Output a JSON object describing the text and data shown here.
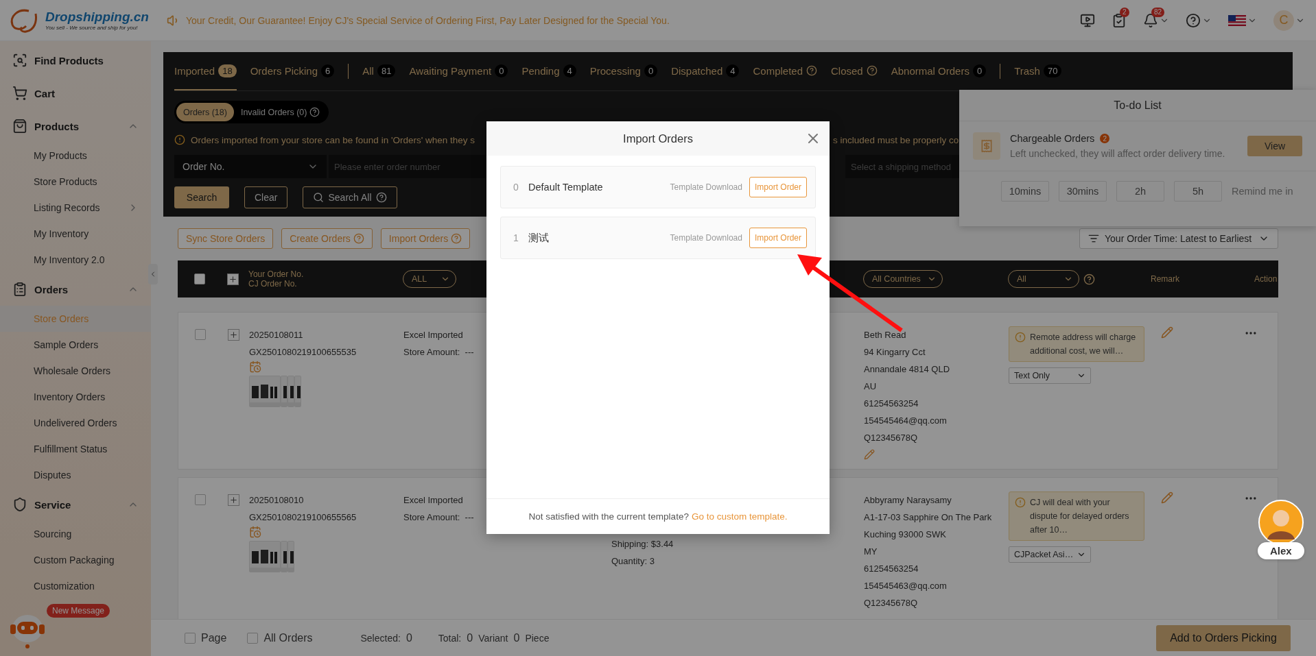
{
  "header": {
    "brand": "Dropshipping.cn",
    "tagline": "You sell - We source and ship for you!",
    "announcement": "Your Credit, Our Guarantee! Enjoy CJ's Special Service of Ordering First, Pay Later Designed for the Special You.",
    "tasks_badge": "2",
    "notifications_badge": "82",
    "avatar_letter": "C"
  },
  "sidebar": {
    "links": [
      {
        "label": "Find Products"
      },
      {
        "label": "Cart"
      }
    ],
    "groups": [
      {
        "label": "Products",
        "expanded": true,
        "children": [
          {
            "label": "My Products",
            "kind": "link",
            "selected": false
          },
          {
            "label": "Store Products",
            "kind": "link",
            "selected": false
          },
          {
            "label": "Listing Records",
            "kind": "submenu",
            "selected": false
          },
          {
            "label": "My Inventory",
            "kind": "link",
            "selected": false
          },
          {
            "label": "My Inventory 2.0",
            "kind": "link",
            "selected": false
          }
        ]
      },
      {
        "label": "Orders",
        "expanded": true,
        "children": [
          {
            "label": "Store Orders",
            "kind": "link",
            "selected": true
          },
          {
            "label": "Sample Orders",
            "kind": "link",
            "selected": false
          },
          {
            "label": "Wholesale Orders",
            "kind": "link",
            "selected": false
          },
          {
            "label": "Inventory Orders",
            "kind": "link",
            "selected": false
          },
          {
            "label": "Undelivered Orders",
            "kind": "link",
            "selected": false
          },
          {
            "label": "Fulfillment Status",
            "kind": "link",
            "selected": false
          },
          {
            "label": "Disputes",
            "kind": "link",
            "selected": false
          }
        ]
      },
      {
        "label": "Service",
        "expanded": true,
        "children": [
          {
            "label": "Sourcing",
            "kind": "link",
            "selected": false
          },
          {
            "label": "Custom Packaging",
            "kind": "link",
            "selected": false
          },
          {
            "label": "Customization",
            "kind": "link",
            "selected": false
          }
        ]
      }
    ]
  },
  "chat": {
    "badge": "New Message"
  },
  "tab_groups": [
    [
      {
        "label": "Imported",
        "kind": "count",
        "count": "18",
        "selected": true
      },
      {
        "label": "Orders Picking",
        "kind": "count",
        "count": "6",
        "selected": false
      }
    ],
    [
      {
        "label": "All",
        "kind": "count",
        "count": "81",
        "selected": false
      },
      {
        "label": "Awaiting Payment",
        "kind": "count",
        "count": "0",
        "selected": false
      },
      {
        "label": "Pending",
        "kind": "count",
        "count": "4",
        "selected": false
      },
      {
        "label": "Processing",
        "kind": "count",
        "count": "0",
        "selected": false
      },
      {
        "label": "Dispatched",
        "kind": "count",
        "count": "4",
        "selected": false
      },
      {
        "label": "Completed",
        "kind": "help",
        "selected": false
      },
      {
        "label": "Closed",
        "kind": "help",
        "selected": false
      },
      {
        "label": "Abnormal Orders",
        "kind": "count",
        "count": "0",
        "selected": false
      }
    ],
    [
      {
        "label": "Trash",
        "kind": "count",
        "count": "70",
        "selected": false
      }
    ]
  ],
  "sub_tabs": [
    {
      "label": "Orders (18)",
      "kind": "plain",
      "selected": true
    },
    {
      "label": "Invalid Orders (0)",
      "kind": "help",
      "selected": false
    }
  ],
  "notice": {
    "before": "Orders imported from your store can be found in 'Orders' when they s",
    "after": "s included must be properly co"
  },
  "filters": {
    "field": "Order No.",
    "search_placeholder": "Please enter order number",
    "shipping_placeholder": "Select a shipping method",
    "search": "Search",
    "clear": "Clear",
    "search_all": "Search All"
  },
  "toolbar": [
    {
      "label": "Sync Store Orders",
      "kind": "plain"
    },
    {
      "label": "Create Orders",
      "kind": "help"
    },
    {
      "label": "Import Orders",
      "kind": "help"
    }
  ],
  "sort": "Your Order Time: Latest to Earliest",
  "table": {
    "checked": false,
    "order_line1": "Your Order No.",
    "order_line2": "CJ Order No.",
    "status_filter": "ALL",
    "country_filter": "All Countries",
    "remark_filter": "All",
    "remark": "Remark",
    "action": "Action"
  },
  "rows": [
    {
      "checked": false,
      "order_no": "20250108011",
      "cj_order_no": "GX2501080219100655535",
      "thumbnails": [
        {
          "kind": "picture"
        },
        {
          "kind": "picture"
        },
        {
          "kind": "picture"
        },
        {
          "kind": "picture"
        }
      ],
      "source": "Excel Imported",
      "store_amount": "Store Amount:  ---",
      "details": [],
      "address": [
        "Beth Read",
        "94 Kingarry Cct",
        "Annandale 4814 QLD",
        "AU",
        "61254563254",
        "154545464@qq.com",
        "Q12345678Q"
      ],
      "address_edit": true,
      "warning": "Remote address will charge additional cost, we will…",
      "shipping": "Text Only"
    },
    {
      "checked": false,
      "order_no": "20250108010",
      "cj_order_no": "GX2501080219100655565",
      "thumbnails": [
        {
          "kind": "picture"
        },
        {
          "kind": "picture"
        },
        {
          "kind": "picture"
        }
      ],
      "source": "Excel Imported",
      "store_amount": "Store Amount:  ---",
      "details": [
        "Shipping: $3.44",
        "Quantity: 3"
      ],
      "address": [
        "Abbyramy Naraysamy",
        "A1-17-03 Sapphire On The Park",
        "Kuching 93000 SWK",
        "MY",
        "61254563254",
        "154545463@qq.com",
        "Q12345678Q"
      ],
      "address_edit": false,
      "warning": "CJ will deal with your dispute for delayed orders after 10…",
      "shipping": "CJPacket Asi…"
    }
  ],
  "footer": {
    "page": "Page",
    "page_checked": false,
    "all": "All Orders",
    "all_checked": false,
    "selected_label": "Selected:",
    "selected_value": "0",
    "total_label": "Total:",
    "variant_count": "0",
    "variant_label": "Variant",
    "piece_count": "0",
    "piece_label": "Piece",
    "action": "Add to Orders Picking"
  },
  "todo": {
    "title": "To-do List",
    "items": [
      {
        "title": "Chargeable Orders",
        "badge": "2",
        "description": "Left unchecked, they will affect order delivery time.",
        "action": "View"
      }
    ],
    "remind_options": [
      "10mins",
      "30mins",
      "2h",
      "5h"
    ],
    "remind_label": "Remind me in"
  },
  "modal": {
    "title": "Import Orders",
    "templates": [
      {
        "index": "0",
        "name": "Default Template",
        "download": "Template Download",
        "action": "Import Order"
      },
      {
        "index": "1",
        "name": "测试",
        "download": "Template Download",
        "action": "Import Order"
      }
    ],
    "footer_text": "Not satisfied with the current template?",
    "footer_link": "Go to custom template."
  },
  "agent": {
    "name": "Alex"
  }
}
